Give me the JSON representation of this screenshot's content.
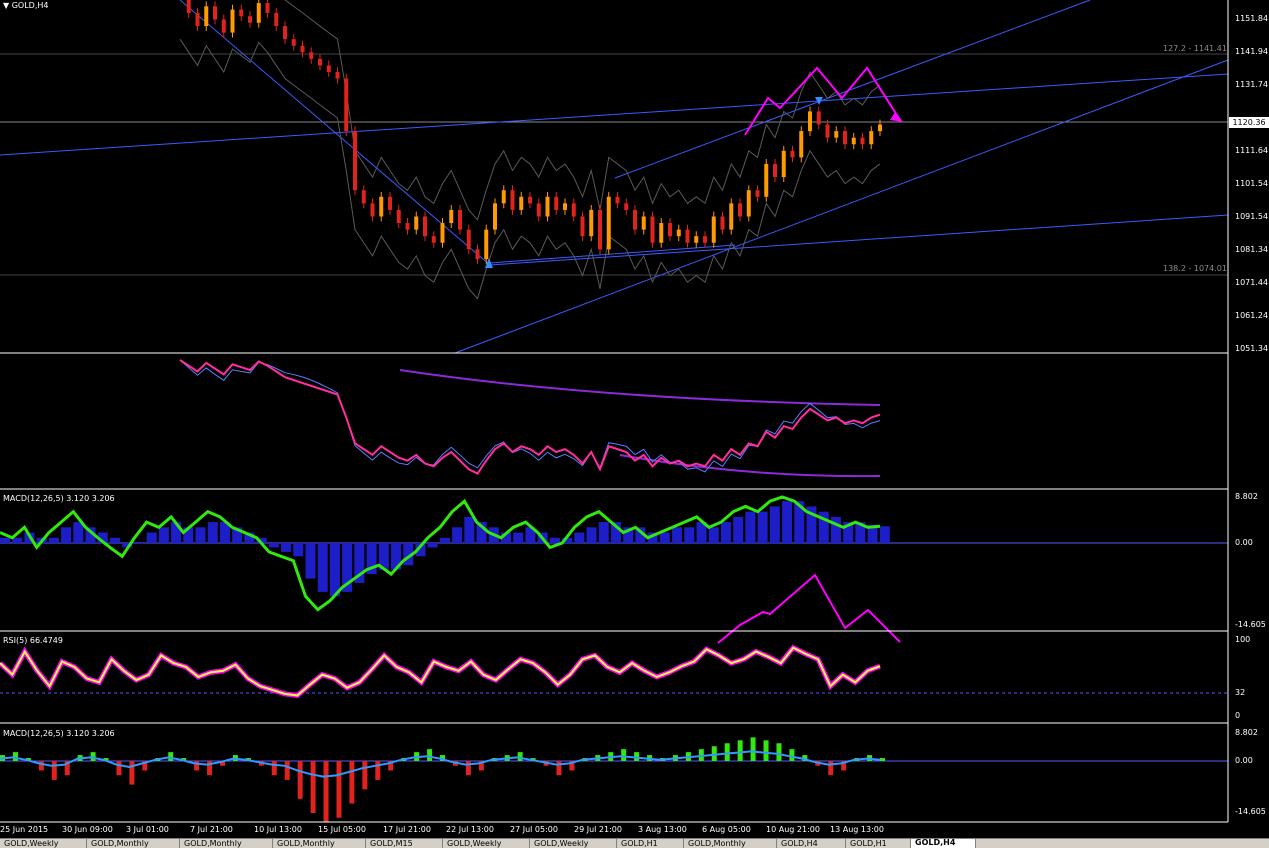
{
  "window": {
    "title": "GOLD,H4"
  },
  "colors": {
    "background": "#000000",
    "bull_candle": "#ff9a00",
    "bear_candle": "#e0231c",
    "bands": "#5a5a5a",
    "trendline": "#3b5bff",
    "pattern": "#ff00ff",
    "macd_line": "#31e80f",
    "macd_hist": "#1e1ec8",
    "rsi": "#ffff33"
  },
  "price_axis": {
    "labels": [
      "1151.84",
      "1141.94",
      "1131.74",
      "1120.36",
      "1111.64",
      "1101.54",
      "1091.54",
      "1081.34",
      "1071.44",
      "1061.24",
      "1051.34"
    ],
    "current_price": "1120.36"
  },
  "fibo": {
    "upper": "127.2 - 1141.41",
    "lower": "138.2 - 1074.01"
  },
  "time_axis": {
    "labels": [
      "25 Jun 2015",
      "30 Jun 09:00",
      "3 Jul 01:00",
      "7 Jul 21:00",
      "10 Jul 13:00",
      "15 Jul 05:00",
      "17 Jul 21:00",
      "22 Jul 13:00",
      "27 Jul 05:00",
      "29 Jul 21:00",
      "3 Aug 13:00",
      "6 Aug 05:00",
      "10 Aug 21:00",
      "13 Aug 13:00"
    ]
  },
  "indicators": {
    "macd1": {
      "label": "MACD(12,26,5) 3.120 3.206",
      "scale": [
        "8.802",
        "0.00",
        "-14.605"
      ]
    },
    "rsi": {
      "label": "RSI(5) 66.4749",
      "scale": [
        "100",
        "32",
        "0"
      ]
    },
    "macd2": {
      "label": "MACD(12,26,5) 3.120 3.206",
      "scale": [
        "8.802",
        "0.00",
        "-14.605"
      ]
    }
  },
  "tabs": [
    "GOLD,Weekly",
    "GOLD,Monthly",
    "GOLD,Monthly",
    "GOLD,Monthly",
    "GOLD,M15",
    "GOLD,Weekly",
    "GOLD,Weekly",
    "GOLD,H1",
    "GOLD,Monthly",
    "GOLD,H4",
    "GOLD,H1",
    "GOLD,H4"
  ],
  "active_tab": 11,
  "chart_data": {
    "type": "candlestick",
    "title": "GOLD,H4",
    "ylim": [
      1051.34,
      1155
    ],
    "price_path": [
      1158,
      1154,
      1150,
      1156,
      1152,
      1148,
      1155,
      1153,
      1151,
      1157,
      1154,
      1150,
      1146,
      1144,
      1142,
      1140,
      1138,
      1136,
      1134,
      1118,
      1100,
      1096,
      1092,
      1098,
      1094,
      1090,
      1088,
      1092,
      1086,
      1084,
      1090,
      1094,
      1088,
      1082,
      1079,
      1088,
      1096,
      1100,
      1094,
      1098,
      1096,
      1092,
      1098,
      1094,
      1096,
      1092,
      1086,
      1094,
      1082,
      1098,
      1096,
      1094,
      1088,
      1092,
      1084,
      1090,
      1086,
      1088,
      1084,
      1086,
      1084,
      1092,
      1088,
      1096,
      1092,
      1100,
      1098,
      1108,
      1104,
      1112,
      1110,
      1118,
      1124,
      1120,
      1116,
      1118,
      1114,
      1116,
      1114,
      1118,
      1120
    ],
    "macd": [
      2,
      1,
      3,
      -1,
      2,
      4,
      6,
      3,
      1,
      -1,
      -3,
      1,
      4,
      3,
      5,
      2,
      4,
      6,
      5,
      3,
      2,
      1,
      -2,
      -3,
      -4,
      -12,
      -15,
      -13,
      -10,
      -8,
      -6,
      -5,
      -7,
      -4,
      -2,
      1,
      3,
      6,
      8,
      4,
      2,
      1,
      3,
      4,
      2,
      -1,
      0,
      3,
      5,
      6,
      4,
      2,
      3,
      1,
      2,
      3,
      4,
      5,
      3,
      4,
      6,
      7,
      6,
      8,
      8.8,
      8,
      6,
      5,
      4,
      3,
      4,
      3,
      3.2
    ],
    "macd_signal": [
      1,
      1,
      2,
      1,
      1,
      3,
      4,
      3,
      2,
      1,
      -1,
      0,
      2,
      3,
      4,
      3,
      3,
      4,
      4,
      3,
      2,
      1,
      -1,
      -2,
      -3,
      -8,
      -11,
      -12,
      -11,
      -9,
      -7,
      -6,
      -6,
      -5,
      -3,
      -1,
      1,
      3,
      5,
      4,
      3,
      2,
      2,
      3,
      2,
      1,
      1,
      2,
      3,
      4,
      4,
      3,
      3,
      2,
      2,
      3,
      3,
      4,
      3,
      4,
      5,
      6,
      6,
      7,
      8,
      8,
      7,
      6,
      5,
      4,
      4,
      3.5,
      3.2
    ],
    "rsi": [
      70,
      55,
      85,
      60,
      40,
      72,
      65,
      50,
      45,
      75,
      60,
      48,
      55,
      80,
      70,
      65,
      52,
      58,
      60,
      68,
      50,
      40,
      35,
      30,
      28,
      42,
      55,
      50,
      38,
      45,
      62,
      80,
      65,
      58,
      45,
      72,
      65,
      60,
      72,
      55,
      48,
      62,
      75,
      70,
      58,
      42,
      55,
      75,
      80,
      65,
      58,
      70,
      60,
      52,
      58,
      66,
      72,
      88,
      80,
      70,
      75,
      85,
      78,
      70,
      90,
      82,
      75,
      40,
      55,
      45,
      60,
      66
    ],
    "macd2_hist": [
      2,
      3,
      1,
      -2,
      -4,
      -3,
      2,
      3,
      1,
      -3,
      -5,
      -2,
      1,
      3,
      1,
      -2,
      -3,
      -1,
      2,
      1,
      -1,
      -3,
      -4,
      -8,
      -11,
      -13,
      -12,
      -9,
      -6,
      -4,
      -2,
      1,
      3,
      4,
      2,
      -1,
      -3,
      -2,
      1,
      2,
      3,
      1,
      -1,
      -3,
      -2,
      1,
      2,
      3,
      4,
      3,
      2,
      1,
      2,
      3,
      4,
      5,
      6,
      7,
      8,
      7,
      6,
      4,
      2,
      -1,
      -3,
      -2,
      1,
      2,
      1
    ]
  }
}
